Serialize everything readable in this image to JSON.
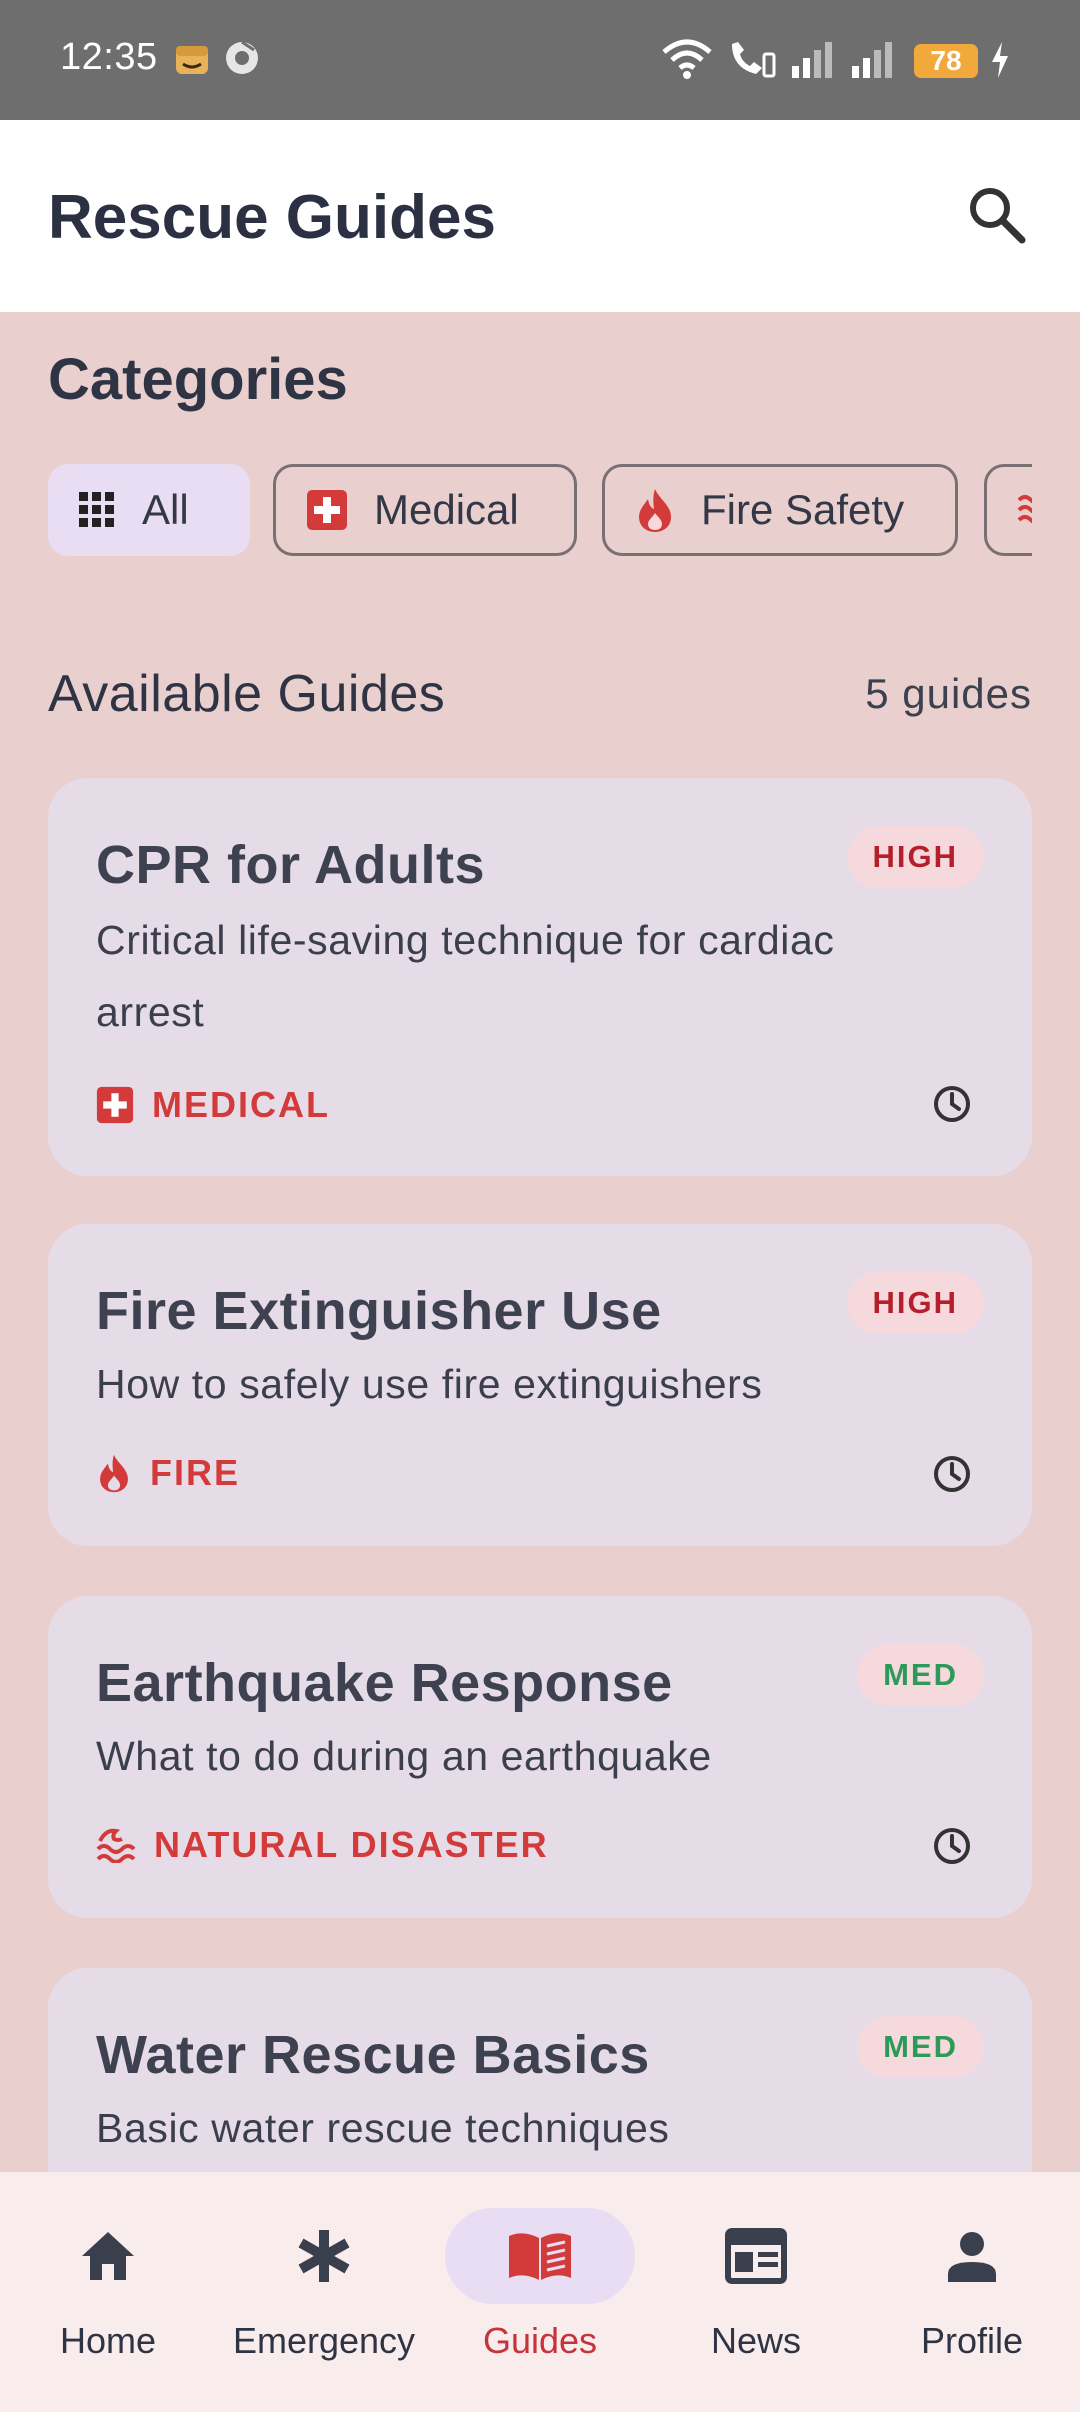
{
  "status_bar": {
    "time": "12:35",
    "battery": "78"
  },
  "app_bar": {
    "title": "Rescue Guides"
  },
  "categories": {
    "title": "Categories",
    "chips": [
      {
        "label": "All",
        "icon": "grid-icon",
        "selected": true
      },
      {
        "label": "Medical",
        "icon": "medical-cross-icon",
        "selected": false
      },
      {
        "label": "Fire Safety",
        "icon": "flame-icon",
        "selected": false
      },
      {
        "label": "",
        "icon": "waves-icon",
        "selected": false
      }
    ]
  },
  "guides": {
    "title": "Available Guides",
    "count": "5 guides",
    "items": [
      {
        "title": "CPR for Adults",
        "description": "Critical life-saving technique for cardiac arrest",
        "priority": "HIGH",
        "category": "MEDICAL",
        "category_icon": "medical-cross-icon"
      },
      {
        "title": "Fire Extinguisher Use",
        "description": "How to safely use fire extinguishers",
        "priority": "HIGH",
        "category": "FIRE",
        "category_icon": "flame-icon"
      },
      {
        "title": "Earthquake Response",
        "description": "What to do during an earthquake",
        "priority": "MED",
        "category": "NATURAL DISASTER",
        "category_icon": "waves-icon"
      },
      {
        "title": "Water Rescue Basics",
        "description": "Basic water rescue techniques",
        "priority": "MED"
      }
    ]
  },
  "bottom_nav": {
    "items": [
      {
        "label": "Home",
        "icon": "home-icon",
        "active": false
      },
      {
        "label": "Emergency",
        "icon": "asterisk-icon",
        "active": false
      },
      {
        "label": "Guides",
        "icon": "book-icon",
        "active": true
      },
      {
        "label": "News",
        "icon": "news-icon",
        "active": false
      },
      {
        "label": "Profile",
        "icon": "person-icon",
        "active": false
      }
    ]
  },
  "colors": {
    "accent": "#d33b3b",
    "high": "#b51f2b",
    "med": "#2e9a5a",
    "chip_selected": "#e8ddf3",
    "card": "#e6dce8",
    "background": "#eacfcf"
  }
}
